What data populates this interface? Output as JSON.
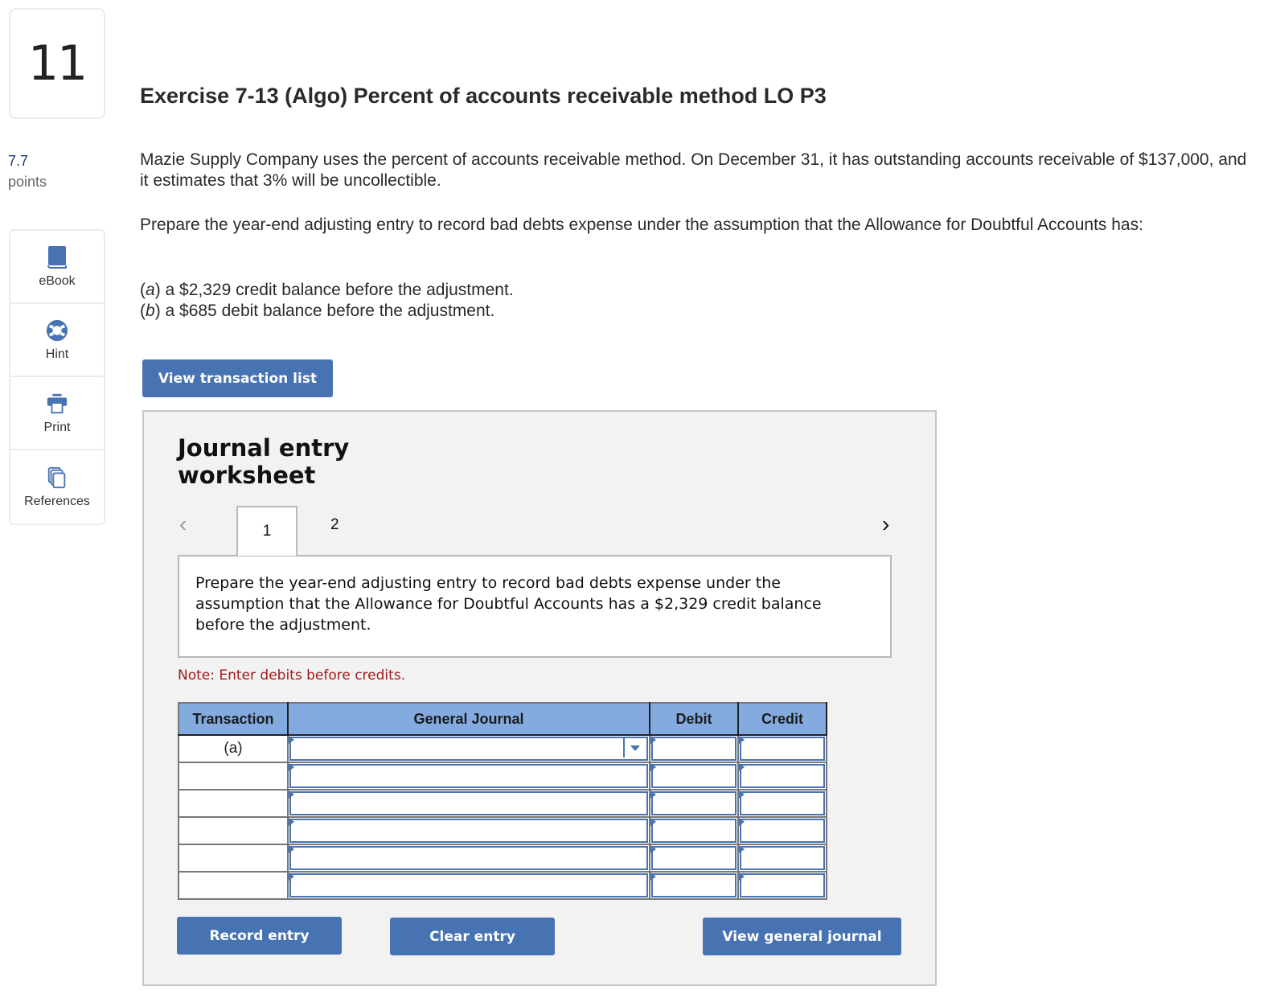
{
  "question": {
    "number": "11",
    "points_value": "7.7",
    "points_label": "points"
  },
  "sidebar": {
    "items": [
      {
        "label": "eBook",
        "icon": "book-icon"
      },
      {
        "label": "Hint",
        "icon": "lifebuoy-icon"
      },
      {
        "label": "Print",
        "icon": "printer-icon"
      },
      {
        "label": "References",
        "icon": "documents-icon"
      }
    ]
  },
  "problem": {
    "title": "Exercise 7-13 (Algo) Percent of accounts receivable method LO P3",
    "paragraph1": "Mazie Supply Company uses the percent of accounts receivable method. On December 31, it has outstanding accounts receivable of $137,000, and it estimates that 3% will be uncollectible.",
    "paragraph2": "Prepare the year-end adjusting entry to record bad debts expense under the assumption that the Allowance for Doubtful Accounts has:",
    "part_a_label": "a",
    "part_a_text": " a $2,329 credit balance before the adjustment.",
    "part_b_label": "b",
    "part_b_text": " a $685 debit balance before the adjustment."
  },
  "buttons": {
    "view_transaction_list": "View transaction list",
    "record_entry": "Record entry",
    "clear_entry": "Clear entry",
    "view_general_journal": "View general journal"
  },
  "worksheet": {
    "title": "Journal entry worksheet",
    "prev_glyph": "‹",
    "next_glyph": "›",
    "tabs": [
      "1",
      "2"
    ],
    "active_tab": "1",
    "instruction": "Prepare the year-end adjusting entry to record bad debts expense under the assumption that the Allowance for Doubtful Accounts has a $2,329 credit balance before the adjustment.",
    "note": "Note: Enter debits before credits."
  },
  "journal_table": {
    "headers": [
      "Transaction",
      "General Journal",
      "Debit",
      "Credit"
    ],
    "rows": [
      {
        "transaction": "(a)",
        "account": "",
        "debit": "",
        "credit": ""
      },
      {
        "transaction": "",
        "account": "",
        "debit": "",
        "credit": ""
      },
      {
        "transaction": "",
        "account": "",
        "debit": "",
        "credit": ""
      },
      {
        "transaction": "",
        "account": "",
        "debit": "",
        "credit": ""
      },
      {
        "transaction": "",
        "account": "",
        "debit": "",
        "credit": ""
      },
      {
        "transaction": "",
        "account": "",
        "debit": "",
        "credit": ""
      }
    ]
  },
  "colors": {
    "accent": "#4873b2",
    "header_fill": "#84abe0",
    "note_red": "#a31b1b",
    "points_blue": "#1b3e72"
  }
}
